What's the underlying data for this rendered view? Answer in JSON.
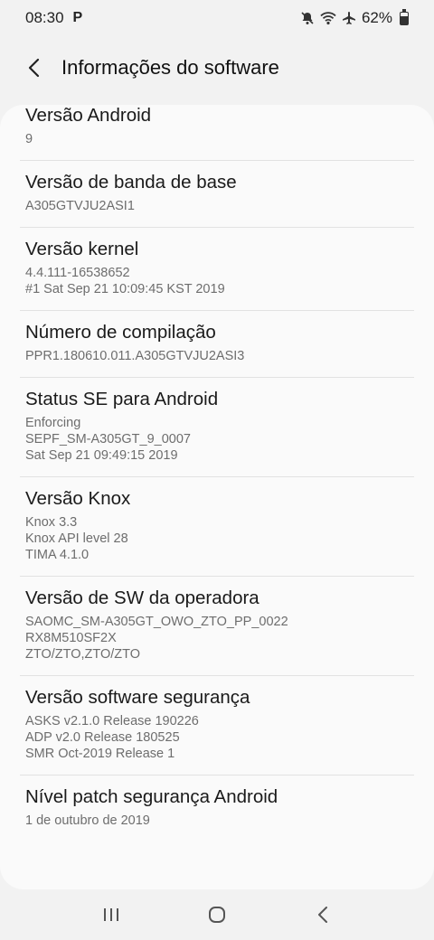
{
  "status_bar": {
    "time": "08:30",
    "notification": "P",
    "battery": "62%",
    "battery_level": 0.62
  },
  "header": {
    "title": "Informações do software"
  },
  "items": [
    {
      "title": "Versão Android",
      "lines": [
        "9"
      ]
    },
    {
      "title": "Versão de banda de base",
      "lines": [
        "A305GTVJU2ASI1"
      ]
    },
    {
      "title": "Versão kernel",
      "lines": [
        "4.4.111-16538652",
        "#1 Sat Sep 21 10:09:45 KST 2019"
      ]
    },
    {
      "title": "Número de compilação",
      "lines": [
        "PPR1.180610.011.A305GTVJU2ASI3"
      ]
    },
    {
      "title": "Status SE para Android",
      "lines": [
        "Enforcing",
        "SEPF_SM-A305GT_9_0007",
        "Sat Sep 21 09:49:15 2019"
      ]
    },
    {
      "title": "Versão Knox",
      "lines": [
        "Knox 3.3",
        "Knox API level 28",
        "TIMA 4.1.0"
      ]
    },
    {
      "title": "Versão de SW da operadora",
      "lines": [
        "SAOMC_SM-A305GT_OWO_ZTO_PP_0022",
        "RX8M510SF2X",
        "ZTO/ZTO,ZTO/ZTO"
      ]
    },
    {
      "title": "Versão software segurança",
      "lines": [
        "ASKS v2.1.0 Release 190226",
        "ADP v2.0 Release 180525",
        "SMR Oct-2019 Release 1"
      ]
    },
    {
      "title": "Nível patch segurança Android",
      "lines": [
        "1 de outubro de 2019"
      ]
    }
  ]
}
